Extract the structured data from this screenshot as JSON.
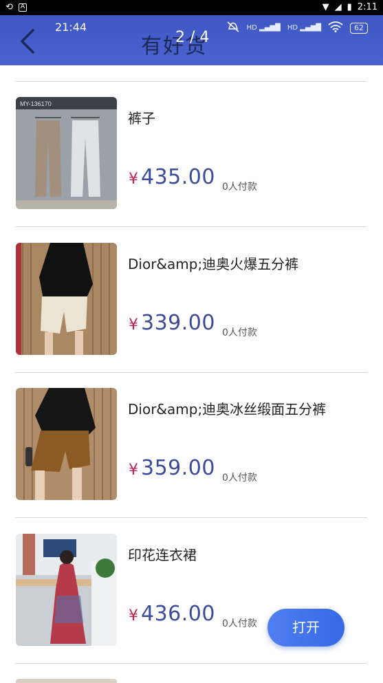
{
  "system_status": {
    "time": "2:11",
    "icons": [
      "sync-icon",
      "notification-a-icon",
      "wifi-icon",
      "signal-icon",
      "battery-icon"
    ]
  },
  "header": {
    "inner_time": "21:44",
    "title": "有好货",
    "page_indicator": "2 / 4",
    "battery_level": "62",
    "hd_label": "HD"
  },
  "products": [
    {
      "name": "裤子",
      "currency": "¥",
      "price": "435.00",
      "paid": "0人付款"
    },
    {
      "name": "Dior&amp;迪奥火爆五分裤",
      "currency": "¥",
      "price": "339.00",
      "paid": "0人付款"
    },
    {
      "name": "Dior&amp;迪奥冰丝缎面五分裤",
      "currency": "¥",
      "price": "359.00",
      "paid": "0人付款"
    },
    {
      "name": "印花连衣裙",
      "currency": "¥",
      "price": "436.00",
      "paid": "0人付款"
    }
  ],
  "thumb_label": "MY-136170",
  "open_button": "打开",
  "colors": {
    "header": "#4a63d0",
    "price": "#3b4a9a",
    "currency": "#c32150",
    "button": "#3f70ea"
  }
}
